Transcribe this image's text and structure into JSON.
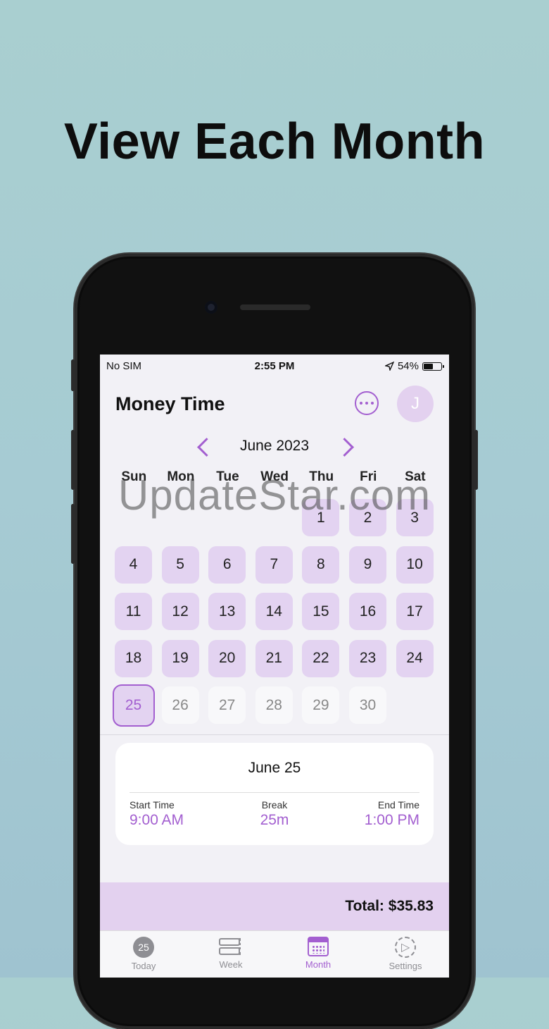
{
  "headline": "View Each Month",
  "watermark": "UpdateStar.com",
  "status_bar": {
    "carrier": "No SIM",
    "time": "2:55 PM",
    "battery": "54%",
    "battery_level": 0.54
  },
  "app": {
    "title": "Money Time",
    "avatar_initial": "J",
    "accent_color": "#a35fd0"
  },
  "calendar": {
    "month_label": "June 2023",
    "weekdays": [
      "Sun",
      "Mon",
      "Tue",
      "Wed",
      "Thu",
      "Fri",
      "Sat"
    ],
    "days": [
      "1",
      "2",
      "3",
      "4",
      "5",
      "6",
      "7",
      "8",
      "9",
      "10",
      "11",
      "12",
      "13",
      "14",
      "15",
      "16",
      "17",
      "18",
      "19",
      "20",
      "21",
      "22",
      "23",
      "24",
      "25",
      "26",
      "27",
      "28",
      "29",
      "30"
    ],
    "selected_day": "25"
  },
  "detail": {
    "date": "June 25",
    "start_label": "Start Time",
    "start_value": "9:00 AM",
    "break_label": "Break",
    "break_value": "25m",
    "end_label": "End Time",
    "end_value": "1:00 PM"
  },
  "total": "Total: $35.83",
  "tabs": [
    {
      "label": "Today",
      "icon": "today-icon",
      "badge": "25"
    },
    {
      "label": "Week",
      "icon": "week-icon"
    },
    {
      "label": "Month",
      "icon": "month-calendar-icon"
    },
    {
      "label": "Settings",
      "icon": "settings-gear-icon"
    }
  ]
}
